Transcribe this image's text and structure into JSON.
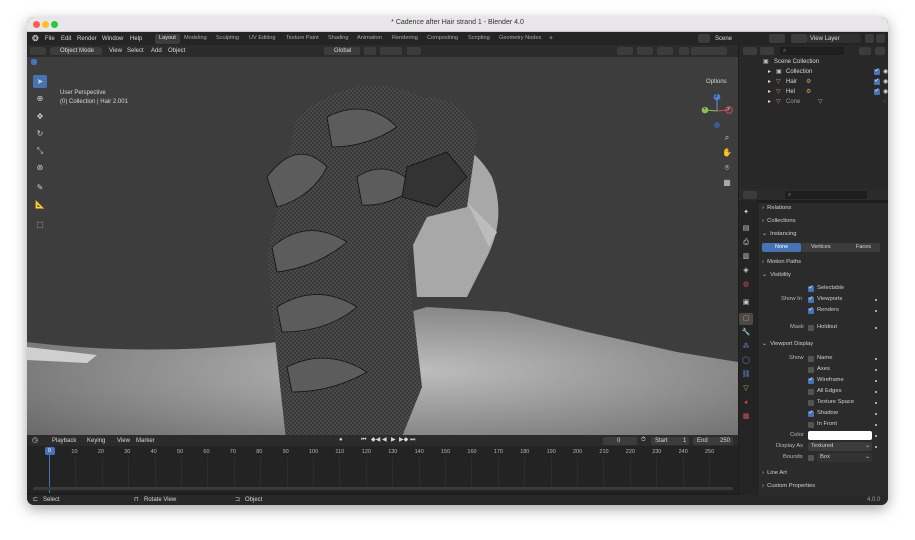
{
  "window": {
    "title": "* Cadence after Hair strand 1 - Blender 4.0"
  },
  "top_menu": {
    "items": [
      "File",
      "Edit",
      "Render",
      "Window",
      "Help"
    ],
    "workspaces": [
      "Layout",
      "Modeling",
      "Sculpting",
      "UV Editing",
      "Texture Paint",
      "Shading",
      "Animation",
      "Rendering",
      "Compositing",
      "Scripting",
      "Geometry Nodes"
    ],
    "active_workspace": "Layout",
    "add_workspace": "+",
    "scene": "Scene",
    "view_layer": "View Layer"
  },
  "viewport_header": {
    "mode": "Object Mode",
    "menus": [
      "View",
      "Select",
      "Add",
      "Object"
    ],
    "orientation": "Global",
    "options": "Options"
  },
  "viewport": {
    "perspective": "User Perspective",
    "context": "(0) Collection | Hair 2.001",
    "gizmo": {
      "z": "Z",
      "y": "Y",
      "x": "X"
    }
  },
  "outliner": {
    "root": "Scene Collection",
    "rows": [
      {
        "name": "Collection"
      },
      {
        "name": "Hair"
      },
      {
        "name": "Hel"
      },
      {
        "name": "Cone"
      }
    ]
  },
  "properties": {
    "sections": {
      "relations": "Relations",
      "collections": "Collections",
      "instancing": "Instancing",
      "motion_paths": "Motion Paths",
      "visibility": "Visibility",
      "viewport_display": "Viewport Display",
      "line_art": "Line Art",
      "custom_properties": "Custom Properties"
    },
    "instancing_options": [
      "None",
      "Vertices",
      "Faces"
    ],
    "instancing_selected": "None",
    "visibility": {
      "selectable": "Selectable",
      "show_in": "Show In",
      "viewports": "Viewports",
      "renders": "Renders",
      "mask": "Mask",
      "holdout": "Holdout"
    },
    "viewport_display": {
      "show": "Show",
      "name": "Name",
      "axes": "Axes",
      "wireframe": "Wireframe",
      "all_edges": "All Edges",
      "texture_space": "Texture Space",
      "shadow": "Shadow",
      "in_front": "In Front",
      "color": "Color",
      "display_as": "Display As",
      "display_as_value": "Textured",
      "bounds": "Bounds",
      "bounds_value": "Box",
      "color_value": "#ffffff"
    }
  },
  "timeline": {
    "menus": [
      "Playback",
      "Keying",
      "View",
      "Marker"
    ],
    "current_frame": "0",
    "start_label": "Start",
    "start": "1",
    "end_label": "End",
    "end": "250",
    "ticks": [
      "0",
      "10",
      "20",
      "30",
      "40",
      "50",
      "60",
      "70",
      "80",
      "90",
      "100",
      "110",
      "120",
      "130",
      "140",
      "150",
      "160",
      "170",
      "180",
      "190",
      "200",
      "210",
      "220",
      "230",
      "240",
      "250"
    ]
  },
  "status_bar": {
    "select": "Select",
    "rotate": "Rotate View",
    "object": "Object",
    "version": "4.0.0"
  },
  "colors": {
    "accent": "#4772b3",
    "viewport_bg": "#3d3d3d",
    "panel_bg": "#2b2b2b",
    "frame_indicator": "#4772b3"
  }
}
